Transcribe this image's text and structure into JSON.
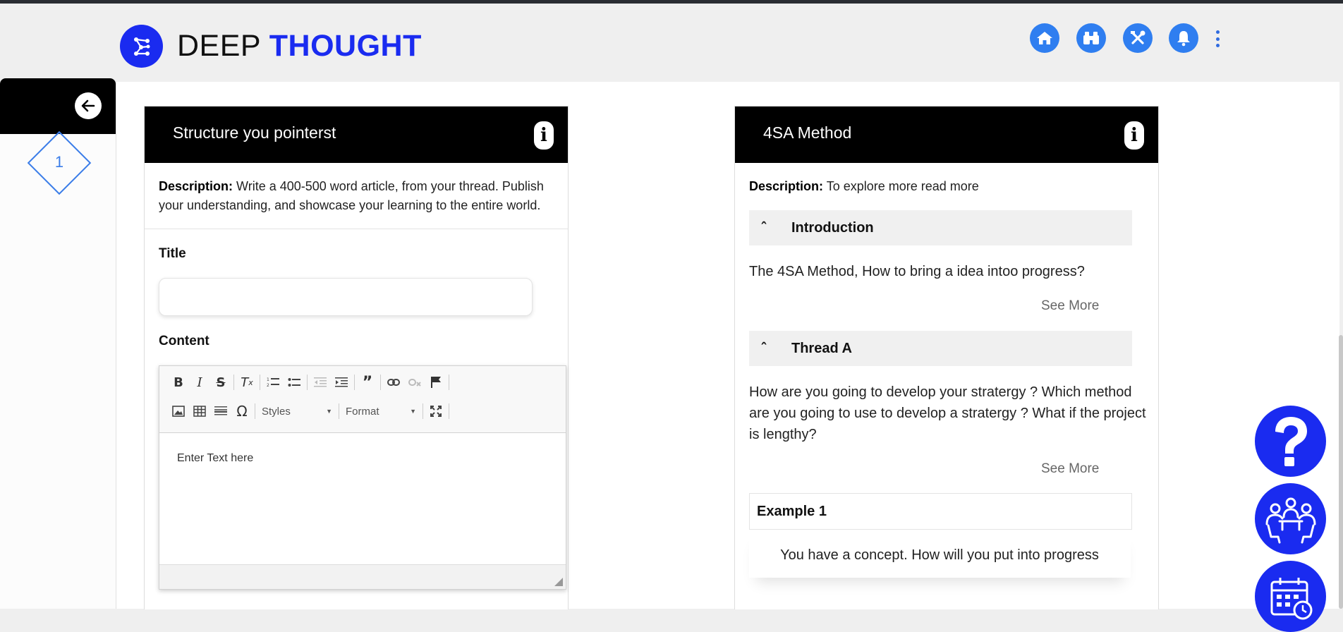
{
  "header": {
    "brand_part1": "DEEP",
    "brand_part2": "THOUGHT",
    "nav_icons": [
      "home-icon",
      "binoculars-icon",
      "tools-icon",
      "bell-icon",
      "more-vertical-icon"
    ]
  },
  "sidebar": {
    "back_icon": "arrow-left-icon",
    "steps": [
      "1"
    ]
  },
  "left_card": {
    "title": "Structure you pointerst",
    "info_icon": "info-icon",
    "description_label": "Description:",
    "description_text": "Write a 400-500 word article, from your thread. Publish your understanding, and showcase your learning to the entire world.",
    "title_label": "Title",
    "title_value": "",
    "content_label": "Content",
    "editor": {
      "styles_label": "Styles",
      "format_label": "Format",
      "placeholder": "Enter Text here"
    }
  },
  "right_card": {
    "title": "4SA Method",
    "info_icon": "info-icon",
    "description_label": "Description:",
    "description_text": "To explore more read more",
    "sections": [
      {
        "label": "Introduction",
        "text": "The 4SA Method, How to bring a idea intoo progress?",
        "see_more": "See More"
      },
      {
        "label": "Thread A",
        "text": "How are you going to develop your stratergy ? Which method are you going to use to develop a stratergy ? What if the project is lengthy?",
        "see_more": "See More"
      }
    ],
    "example_label": "Example 1",
    "example_text": "You have a concept. How will you put into progress"
  },
  "floating_buttons": [
    "help-question-icon",
    "team-meeting-icon",
    "calendar-icon"
  ],
  "colors": {
    "brand_blue": "#1a2bf0",
    "nav_blue": "#2f7ef0",
    "step_blue": "#3b7de8",
    "header_black": "#000000"
  }
}
